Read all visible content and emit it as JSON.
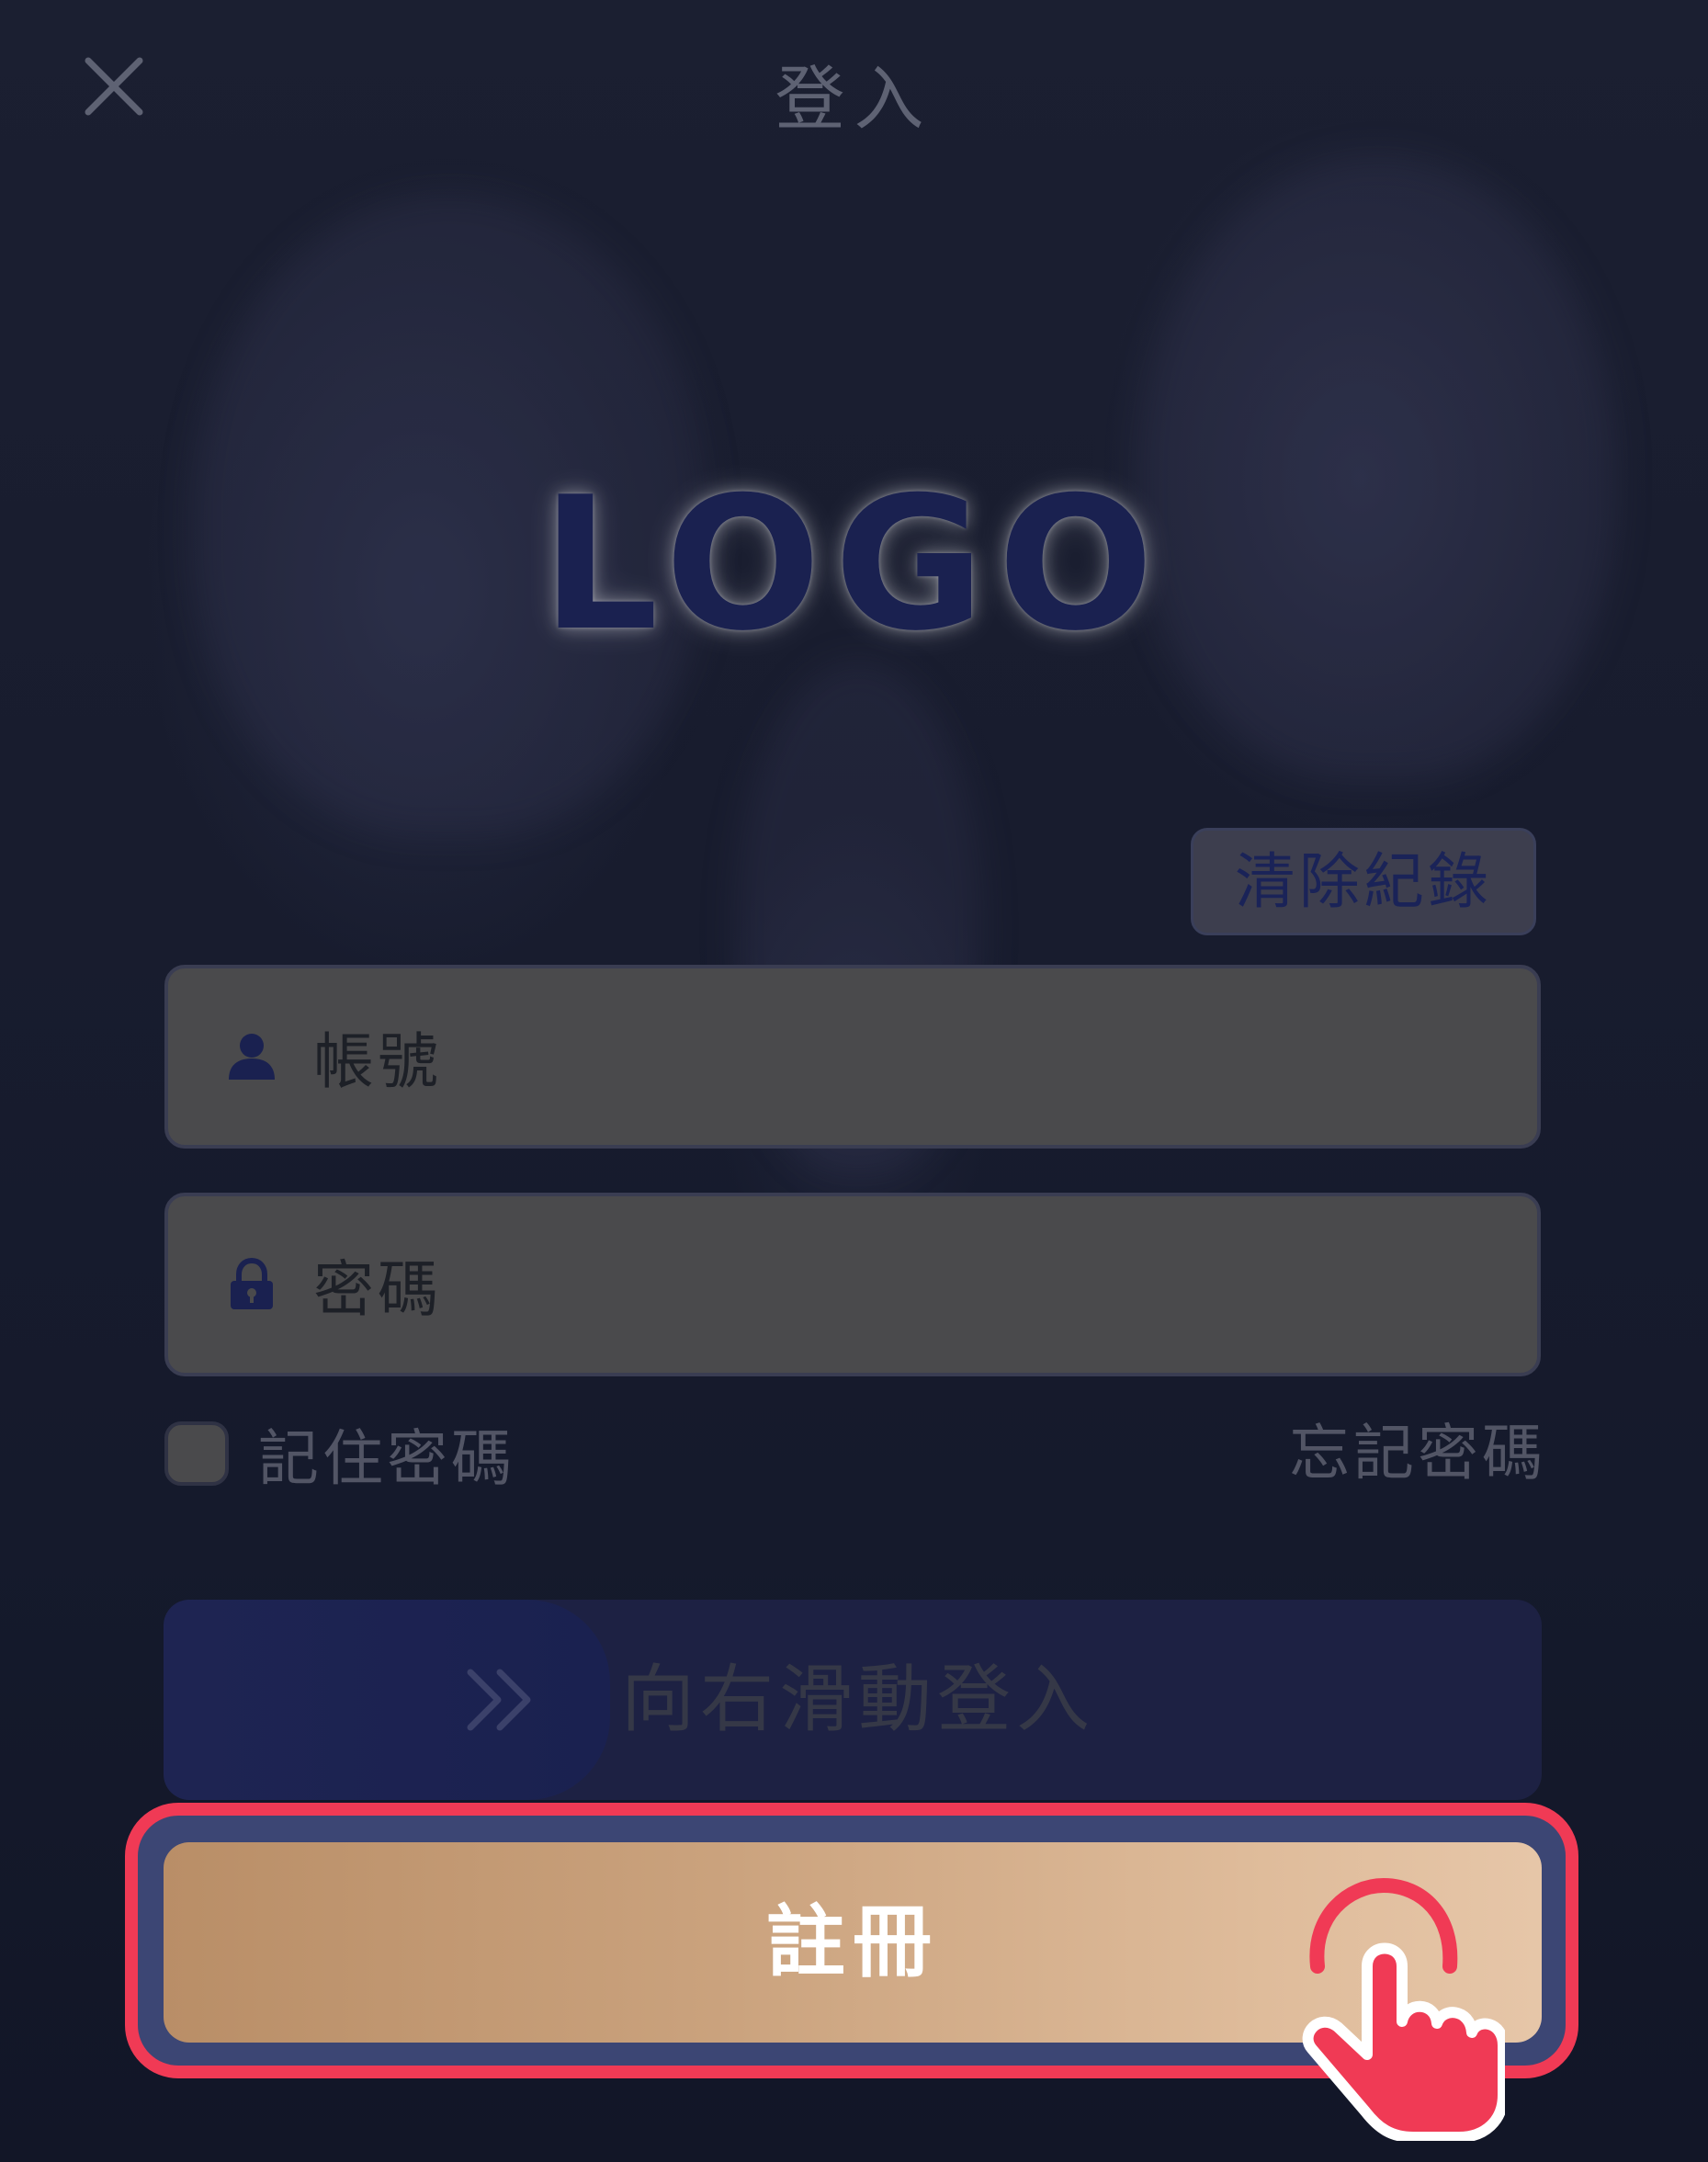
{
  "header": {
    "title": "登入",
    "close_icon": "close-icon"
  },
  "logo": {
    "text": "LOGO"
  },
  "clear_records": {
    "label": "清除紀錄"
  },
  "account_field": {
    "icon": "user-icon",
    "placeholder": "帳號"
  },
  "password_field": {
    "icon": "lock-icon",
    "placeholder": "密碼"
  },
  "remember": {
    "label": "記住密碼",
    "checked": false
  },
  "forgot": {
    "label": "忘記密碼"
  },
  "slider": {
    "icon": "double-chevron-right-icon",
    "label": "向右滑動登入"
  },
  "register": {
    "label": "註冊",
    "pointer_icon": "hand-pointer-icon"
  },
  "colors": {
    "background": "#161a2b",
    "highlight": "#f03a55",
    "register_gradient_start": "#b98e67",
    "register_gradient_end": "#e6c6a8",
    "slider_background": "#1d2143",
    "logo": "#1a2150"
  }
}
